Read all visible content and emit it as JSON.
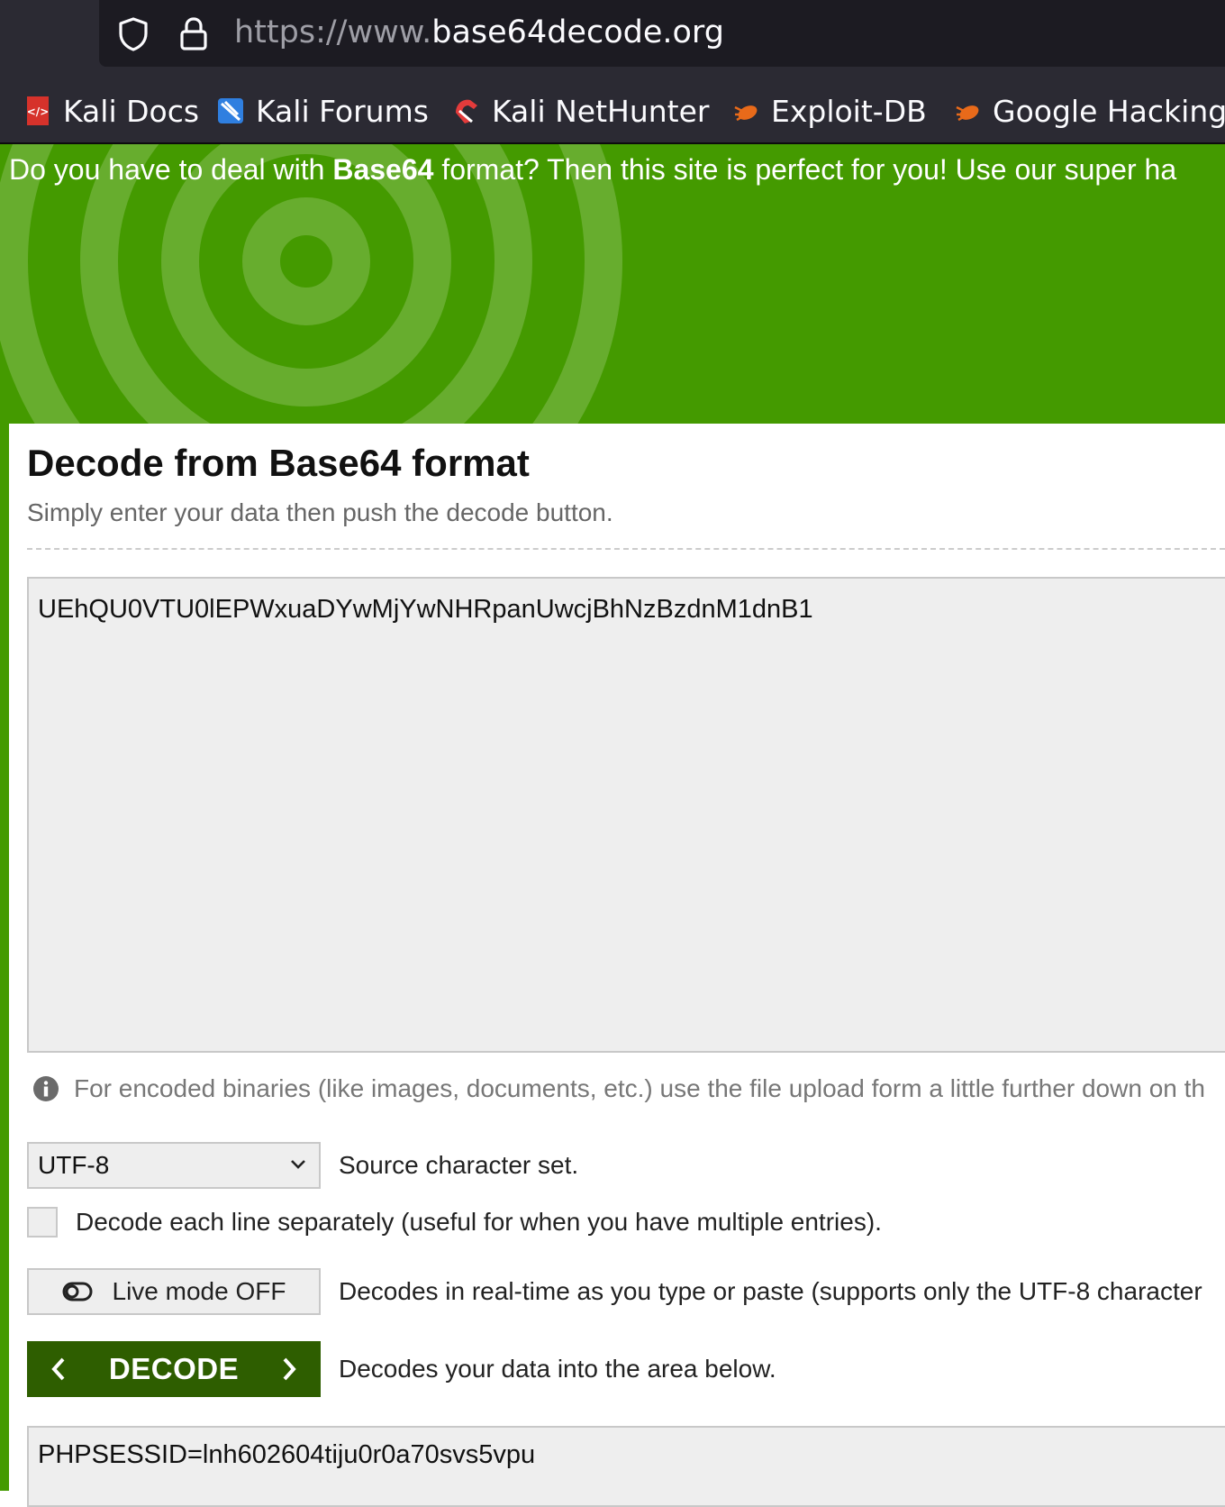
{
  "browser": {
    "url_prefix": "https://www.",
    "url_domain": "base64decode.org",
    "bookmarks": [
      {
        "label": "Kali Docs",
        "icon": "kali-docs-icon"
      },
      {
        "label": "Kali Forums",
        "icon": "kali-forums-icon"
      },
      {
        "label": "Kali NetHunter",
        "icon": "kali-nethunter-icon"
      },
      {
        "label": "Exploit-DB",
        "icon": "exploit-db-icon"
      },
      {
        "label": "Google Hacking",
        "icon": "exploit-db-icon"
      }
    ]
  },
  "hero": {
    "text_before": "Do you have to deal with ",
    "text_bold": "Base64",
    "text_after": " format? Then this site is perfect for you! Use our super ha"
  },
  "main": {
    "title": "Decode from Base64 format",
    "subtitle": "Simply enter your data then push the decode button.",
    "input_value": "UEhQU0VTU0lEPWxuaDYwMjYwNHRpanUwcjBhNzBzdnM1dnB1",
    "hint": "For encoded binaries (like images, documents, etc.) use the file upload form a little further down on th",
    "charset": {
      "selected": "UTF-8",
      "label": "Source character set."
    },
    "decode_each_line": {
      "checked": false,
      "label": "Decode each line separately (useful for when you have multiple entries)."
    },
    "live_mode": {
      "button_label": "Live mode OFF",
      "description": "Decodes in real-time as you type or paste (supports only the UTF-8 character"
    },
    "decode": {
      "button_label": "DECODE",
      "description": "Decodes your data into the area below."
    },
    "output_value": "PHPSESSID=lnh602604tiju0r0a70svs5vpu"
  },
  "colors": {
    "brand_green": "#449a00",
    "button_green": "#2e5e00",
    "chrome_dark": "#2b2a33"
  }
}
